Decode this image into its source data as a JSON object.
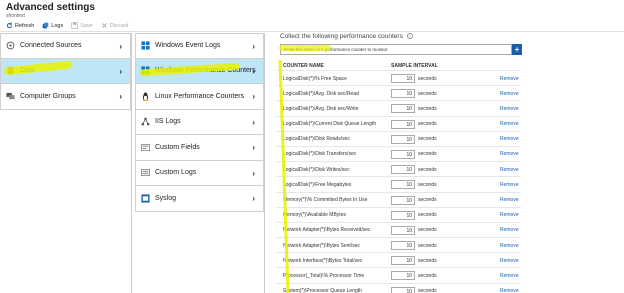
{
  "header": {
    "title": "Advanced settings",
    "subtitle": "shontest"
  },
  "toolbar": {
    "refresh": "Refresh",
    "logs": "Logs",
    "save": "Save",
    "discard": "Discard"
  },
  "sidebar": {
    "items": [
      {
        "label": "Connected Sources",
        "icon": "connected-sources-icon"
      },
      {
        "label": "Data",
        "icon": "data-icon"
      },
      {
        "label": "Computer Groups",
        "icon": "computer-groups-icon"
      }
    ]
  },
  "data_menu": {
    "items": [
      {
        "label": "Windows Event Logs",
        "icon": "windows-icon"
      },
      {
        "label": "Windows Performance Counters",
        "icon": "windows-icon"
      },
      {
        "label": "Linux Performance Counters",
        "icon": "linux-icon"
      },
      {
        "label": "IIS Logs",
        "icon": "iis-icon"
      },
      {
        "label": "Custom Fields",
        "icon": "custom-fields-icon"
      },
      {
        "label": "Custom Logs",
        "icon": "custom-logs-icon"
      },
      {
        "label": "Syslog",
        "icon": "syslog-icon"
      }
    ]
  },
  "counters": {
    "title": "Collect the following performance counters",
    "input_placeholder": "Enter the name of a performance counter to monitor",
    "add_label": "+",
    "col_name": "COUNTER NAME",
    "col_interval": "SAMPLE INTERVAL",
    "unit": "seconds",
    "remove": "Remove",
    "rows": [
      {
        "name": "LogicalDisk(*)\\% Free Space",
        "interval": "10"
      },
      {
        "name": "LogicalDisk(*)\\Avg. Disk sec/Read",
        "interval": "10"
      },
      {
        "name": "LogicalDisk(*)\\Avg. Disk sec/Write",
        "interval": "10"
      },
      {
        "name": "LogicalDisk(*)\\Current Disk Queue Length",
        "interval": "10"
      },
      {
        "name": "LogicalDisk(*)\\Disk Reads/sec",
        "interval": "10"
      },
      {
        "name": "LogicalDisk(*)\\Disk Transfers/sec",
        "interval": "10"
      },
      {
        "name": "LogicalDisk(*)\\Disk Writes/sec",
        "interval": "10"
      },
      {
        "name": "LogicalDisk(*)\\Free Megabytes",
        "interval": "10"
      },
      {
        "name": "Memory(*)\\% Committed Bytes In Use",
        "interval": "10"
      },
      {
        "name": "Memory(*)\\Available MBytes",
        "interval": "10"
      },
      {
        "name": "Network Adapter(*)\\Bytes Received/sec",
        "interval": "10"
      },
      {
        "name": "Network Adapter(*)\\Bytes Sent/sec",
        "interval": "10"
      },
      {
        "name": "Network Interface(*)\\Bytes Total/sec",
        "interval": "10"
      },
      {
        "name": "Processor(_Total)\\% Processor Time",
        "interval": "10"
      },
      {
        "name": "System(*)\\Processor Queue Length",
        "interval": "10"
      }
    ]
  },
  "colors": {
    "selected_bg": "#bee6f7",
    "link": "#1a5dab",
    "highlight": "#e9f200"
  }
}
